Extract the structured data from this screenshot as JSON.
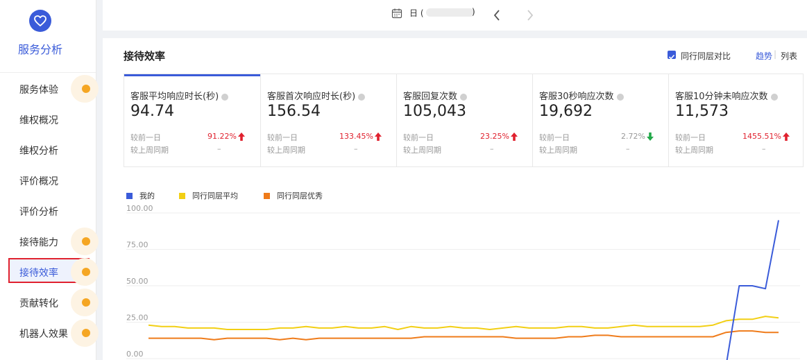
{
  "sidebar": {
    "app_title": "服务分析",
    "items": [
      {
        "label": "服务体验",
        "dot": true,
        "active": false
      },
      {
        "label": "维权概况",
        "dot": false,
        "active": false
      },
      {
        "label": "维权分析",
        "dot": false,
        "active": false
      },
      {
        "label": "评价概况",
        "dot": false,
        "active": false
      },
      {
        "label": "评价分析",
        "dot": false,
        "active": false
      },
      {
        "label": "接待能力",
        "dot": true,
        "active": false
      },
      {
        "label": "接待效率",
        "dot": true,
        "active": true
      },
      {
        "label": "贡献转化",
        "dot": true,
        "active": false
      },
      {
        "label": "机器人效果",
        "dot": true,
        "active": false
      }
    ]
  },
  "topbar": {
    "date_prefix": "日 (",
    "date_suffix": ")",
    "icons": [
      "calendar-icon",
      "chevron-left-icon",
      "chevron-right-icon"
    ]
  },
  "panel": {
    "title": "接待效率",
    "compare_label": "同行同层对比",
    "compare_checked": true,
    "view_trend": "趋势",
    "view_sep": "|",
    "view_list": "列表"
  },
  "kpis": [
    {
      "name": "客服平均响应时长(秒)",
      "value": "94.74",
      "day_label": "较前一日",
      "day_change": "91.22%",
      "direction": "up",
      "week_label": "较上周同期",
      "week_change": "–",
      "selected": true
    },
    {
      "name": "客服首次响应时长(秒)",
      "value": "156.54",
      "day_label": "较前一日",
      "day_change": "133.45%",
      "direction": "up",
      "week_label": "较上周同期",
      "week_change": "–",
      "selected": false
    },
    {
      "name": "客服回复次数",
      "value": "105,043",
      "day_label": "较前一日",
      "day_change": "23.25%",
      "direction": "up",
      "week_label": "较上周同期",
      "week_change": "–",
      "selected": false
    },
    {
      "name": "客服30秒响应次数",
      "value": "19,692",
      "day_label": "较前一日",
      "day_change": "2.72%",
      "direction": "down",
      "week_label": "较上周同期",
      "week_change": "–",
      "selected": false
    },
    {
      "name": "客服10分钟未响应次数",
      "value": "11,573",
      "day_label": "较前一日",
      "day_change": "1455.51%",
      "direction": "up",
      "week_label": "较上周同期",
      "week_change": "–",
      "selected": false
    }
  ],
  "colors": {
    "accent": "#3a5bd9",
    "up": "#e0212e",
    "down": "#22a849",
    "dot": "#f5a623"
  },
  "chart_data": {
    "type": "line",
    "ylim": [
      0,
      100
    ],
    "y_ticks": [
      "100.00",
      "75.00",
      "50.00",
      "25.00",
      "0.00"
    ],
    "legend_position": "top-left",
    "grid": true,
    "series": [
      {
        "name": "我的",
        "color": "#3a5bd9",
        "values": [
          null,
          null,
          null,
          null,
          null,
          null,
          null,
          null,
          null,
          null,
          null,
          null,
          null,
          null,
          null,
          null,
          null,
          null,
          null,
          null,
          null,
          null,
          null,
          null,
          null,
          null,
          null,
          null,
          null,
          null,
          null,
          null,
          null,
          null,
          null,
          null,
          null,
          null,
          null,
          null,
          null,
          null,
          null,
          null,
          -5,
          50,
          50,
          48,
          95
        ]
      },
      {
        "name": "同行同层平均",
        "color": "#f2cf14",
        "values": [
          23,
          22,
          22,
          21,
          21,
          21,
          20,
          20,
          20,
          20,
          21,
          21,
          22,
          21,
          21,
          22,
          21,
          21,
          22,
          20,
          22,
          21,
          21,
          22,
          21,
          21,
          20,
          21,
          22,
          21,
          21,
          21,
          22,
          22,
          21,
          21,
          22,
          23,
          22,
          22,
          22,
          22,
          22,
          23,
          26,
          27,
          27,
          29,
          28
        ]
      },
      {
        "name": "同行同层优秀",
        "color": "#ef7b1a",
        "values": [
          14,
          14,
          14,
          14,
          14,
          13,
          14,
          14,
          14,
          14,
          13,
          14,
          13,
          14,
          14,
          14,
          14,
          14,
          14,
          14,
          14,
          15,
          15,
          15,
          15,
          15,
          15,
          15,
          14,
          14,
          14,
          14,
          15,
          15,
          16,
          16,
          15,
          15,
          15,
          15,
          15,
          15,
          15,
          15,
          18,
          19,
          19,
          18,
          18
        ]
      }
    ]
  }
}
